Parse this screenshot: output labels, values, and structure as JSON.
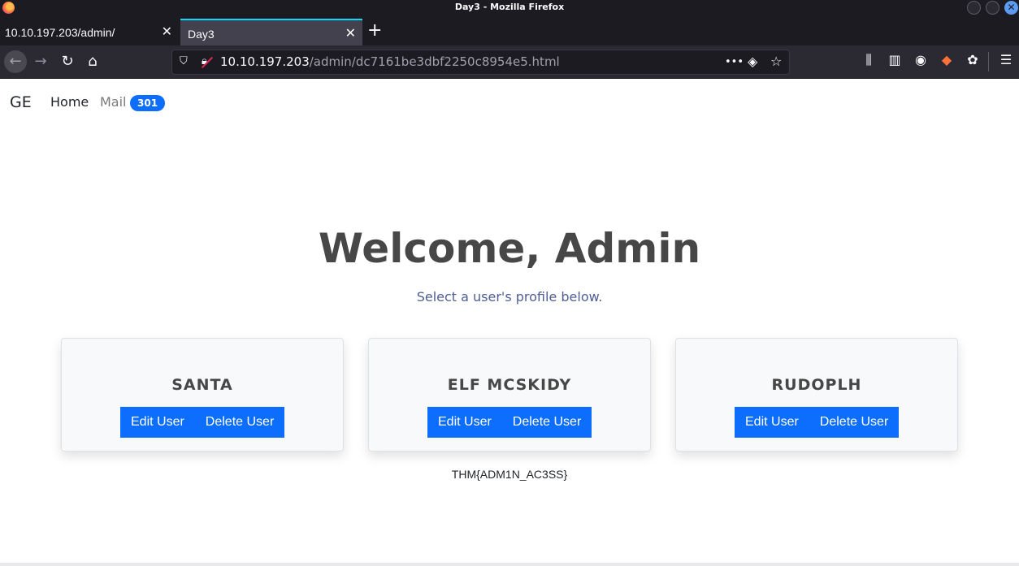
{
  "window": {
    "title": "Day3 - Mozilla Firefox",
    "close_glyph": "✕"
  },
  "tabs": [
    {
      "label": "10.10.197.203/admin/",
      "active": false
    },
    {
      "label": "Day3",
      "active": true
    }
  ],
  "tab_close_glyph": "✕",
  "new_tab_glyph": "+",
  "toolbar": {
    "back_icon": "←",
    "forward_icon": "→",
    "reload_icon": "↻",
    "home_icon": "⌂",
    "url_host": "10.10.197.203",
    "url_path": "/admin/dc7161be3dbf2250c8954e5.html",
    "page_actions_icon": "•••",
    "pocket_icon": "◈",
    "bookmark_icon": "☆",
    "library_icon": "⫼",
    "sidebar_icon": "▥",
    "account_icon": "◉",
    "extension_icon": "◆",
    "cookie_icon": "✿",
    "menu_icon": "☰"
  },
  "site_nav": {
    "brand": "GE",
    "home": "Home",
    "mail": "Mail",
    "mail_count": "301"
  },
  "main": {
    "heading": "Welcome, Admin",
    "subtitle": "Select a user's profile below."
  },
  "users": [
    {
      "name": "SANTA",
      "edit_label": "Edit User",
      "delete_label": "Delete User"
    },
    {
      "name": "ELF MCSKIDY",
      "edit_label": "Edit User",
      "delete_label": "Delete User"
    },
    {
      "name": "RUDOPLH",
      "edit_label": "Edit User",
      "delete_label": "Delete User"
    }
  ],
  "flag": "THM{ADM1N_AC3SS}",
  "colors": {
    "accent": "#0d6efd",
    "heading": "#474747",
    "subtitle": "#4e5d94",
    "browser_dark": "#1c1b22"
  }
}
